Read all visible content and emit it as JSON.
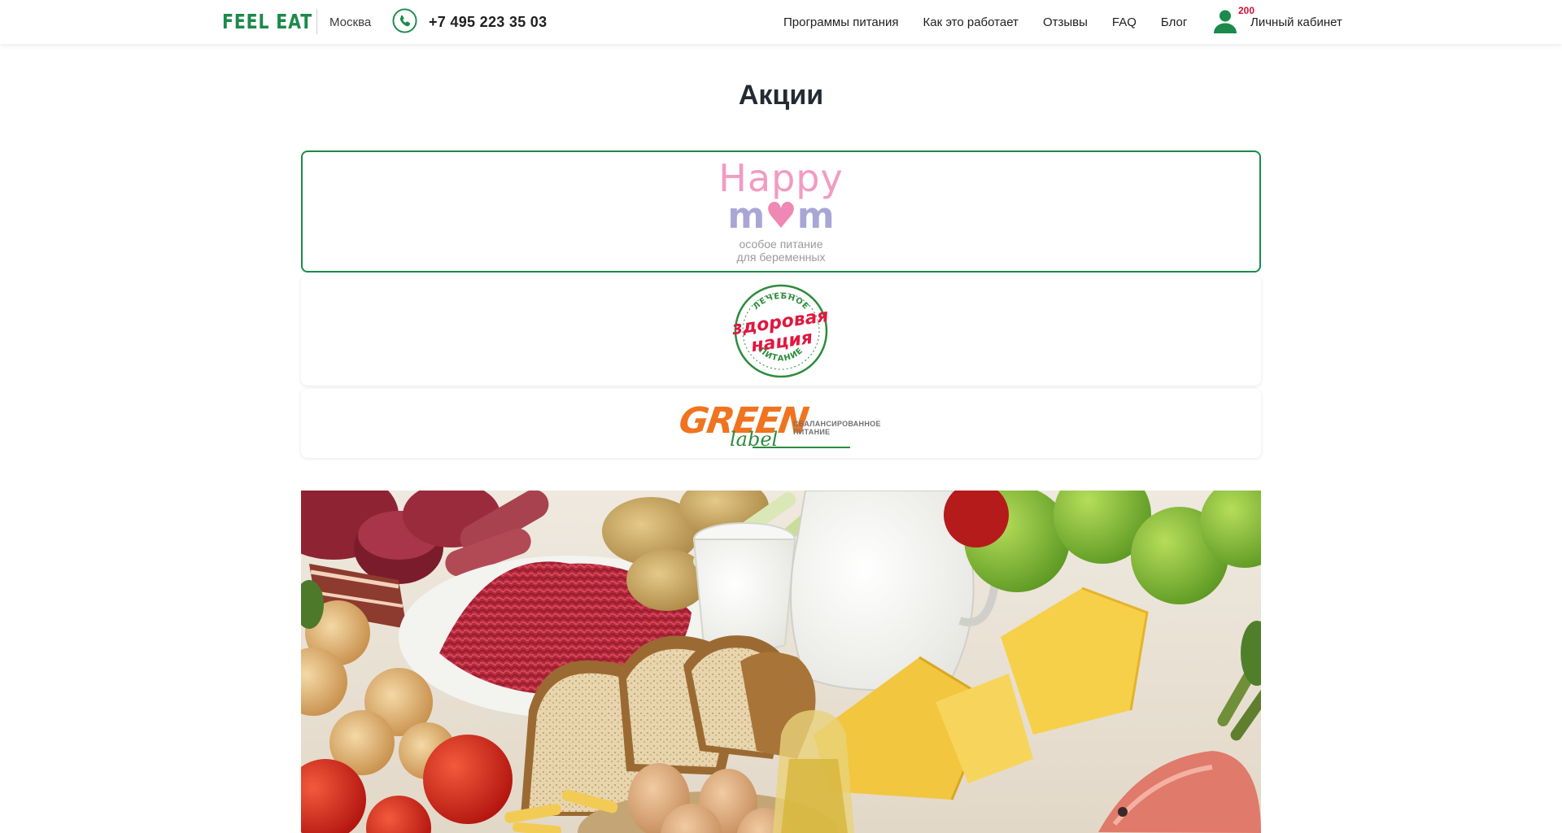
{
  "header": {
    "logo": "FEEL EAT",
    "city": "Москва",
    "phone": "+7 495 223 35 03",
    "nav": [
      "Программы питания",
      "Как это работает",
      "Отзывы",
      "FAQ",
      "Блог"
    ],
    "badge": "200",
    "account": "Личный кабинет"
  },
  "page": {
    "title": "Акции"
  },
  "promos": [
    {
      "name": "Happy mom",
      "line1": "Happy",
      "line2": "m♥m",
      "sub1": "особое питание",
      "sub2": "для беременных",
      "active": true
    },
    {
      "name": "Здоровая нация",
      "top": "ЛЕЧЕБНОЕ",
      "line1": "здоровая",
      "line2": "нация",
      "bottom": "ПИТАНИЕ"
    },
    {
      "name": "Green label",
      "line1": "GREEN",
      "line2": "label",
      "sub1": "СБАЛАНСИРОВАННОЕ",
      "sub2": "ПИТАНИЕ"
    }
  ],
  "colors": {
    "brand_green": "#1b8a4a",
    "badge_red": "#d0103a",
    "happy_pink": "#f29bc2",
    "happy_lilac": "#a9a6d6",
    "nation_red": "#e0173f",
    "green_label_orange": "#f0741f"
  },
  "icons": {
    "phone": "phone-icon",
    "user": "user-icon",
    "heart": "heart-icon"
  }
}
